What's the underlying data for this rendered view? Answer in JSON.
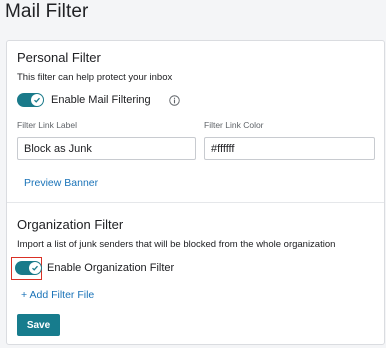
{
  "page": {
    "title": "Mail Filter"
  },
  "personal": {
    "title": "Personal Filter",
    "description": "This filter can help protect your inbox",
    "toggle_label": "Enable Mail Filtering",
    "toggle_on": true,
    "link_label": {
      "label": "Filter Link Label",
      "value": "Block as Junk"
    },
    "link_color": {
      "label": "Filter Link Color",
      "value": "#ffffff"
    },
    "preview_link": "Preview Banner"
  },
  "organization": {
    "title": "Organization Filter",
    "description": "Import a list of junk senders that will be blocked from the whole organization",
    "toggle_label": "Enable Organization Filter",
    "toggle_on": true,
    "add_link": "+ Add Filter File"
  },
  "actions": {
    "save_label": "Save"
  },
  "colors": {
    "accent": "#177c8d",
    "link": "#1a73b8",
    "highlight": "#d93025"
  },
  "icons": {
    "info": "info-icon",
    "check": "check-icon"
  }
}
